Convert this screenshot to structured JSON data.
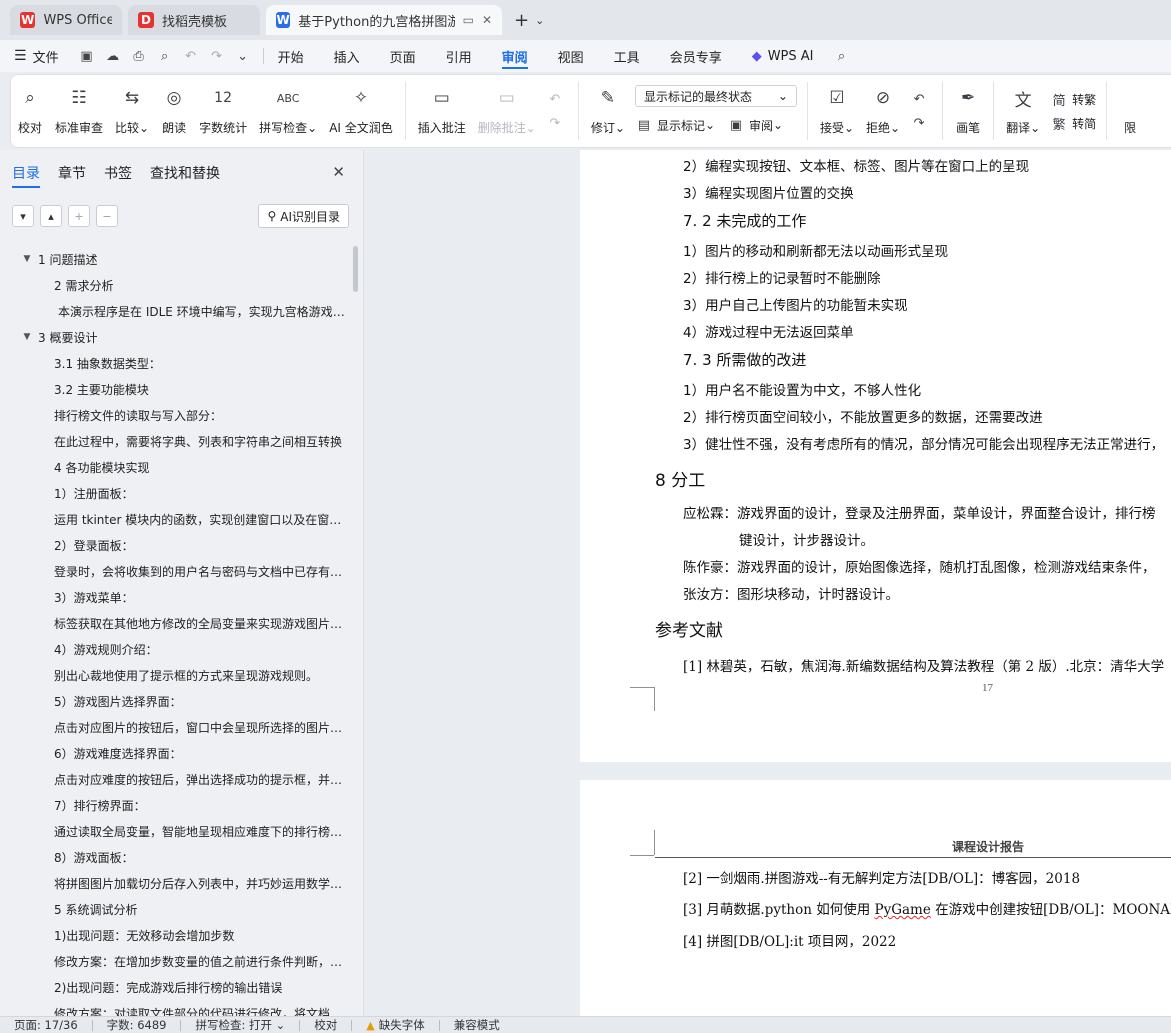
{
  "tabs": [
    {
      "label": "WPS Office",
      "logo": "W",
      "logo_color": "#e8322f"
    },
    {
      "label": "找稻壳模板",
      "logo": "D",
      "logo_color": "#e8322f"
    },
    {
      "label": "基于Python的九宫格拼图游戏",
      "logo": "W",
      "logo_color": "#2a6fe5"
    }
  ],
  "menu": {
    "file": "文件",
    "items": [
      "开始",
      "插入",
      "页面",
      "引用",
      "审阅",
      "视图",
      "工具",
      "会员专享"
    ],
    "active": "审阅",
    "wps_ai": "WPS AI"
  },
  "ribbon": {
    "proofread": "校对",
    "standard_review": "标准审查",
    "compare": "比较",
    "read_aloud": "朗读",
    "word_count": "字数统计",
    "spell_check": "拼写检查",
    "ai_polish": "AI 全文润色",
    "insert_comment": "插入批注",
    "delete_comment": "删除批注",
    "revise": "修订",
    "markup_state": "显示标记的最终状态",
    "show_markup": "显示标记",
    "review": "审阅",
    "accept": "接受",
    "reject": "拒绝",
    "pen": "画笔",
    "translate": "翻译",
    "to_traditional": "转繁",
    "to_simplified": "转简",
    "limit": "限"
  },
  "sidepanel": {
    "tabs": [
      "目录",
      "章节",
      "书签",
      "查找和替换"
    ],
    "ai_button": "AI识别目录",
    "toc": [
      {
        "text": "1  问题描述",
        "level": 1,
        "expanded": true
      },
      {
        "text": "2  需求分析",
        "level": 2
      },
      {
        "text": "本演示程序是在 IDLE 环境中编写，实现九宫格游戏的基本功能",
        "level": 2
      },
      {
        "text": "3  概要设计",
        "level": 1,
        "expanded": true
      },
      {
        "text": "3.1 抽象数据类型：",
        "level": 2
      },
      {
        "text": "3.2  主要功能模块",
        "level": 2
      },
      {
        "text": "排行榜文件的读取与写入部分：",
        "level": 3
      },
      {
        "text": "在此过程中，需要将字典、列表和字符串之间相互转换",
        "level": 3
      },
      {
        "text": "4 各功能模块实现",
        "level": 3
      },
      {
        "text": "1）注册面板：",
        "level": 3
      },
      {
        "text": "运用 tkinter 模块内的函数，实现创建窗口以及在窗口上布局",
        "level": 3
      },
      {
        "text": "2）登录面板：",
        "level": 3
      },
      {
        "text": "登录时，会将收集到的用户名与密码与文档中已存有的信息比对",
        "level": 3
      },
      {
        "text": "3）游戏菜单：",
        "level": 3
      },
      {
        "text": "标签获取在其他地方修改的全局变量来实现游戏图片的切换",
        "level": 3
      },
      {
        "text": "4）游戏规则介绍：",
        "level": 3
      },
      {
        "text": "别出心裁地使用了提示框的方式来呈现游戏规则。",
        "level": 3
      },
      {
        "text": "5）游戏图片选择界面：",
        "level": 3
      },
      {
        "text": "点击对应图片的按钮后，窗口中会呈现所选择的图片样式",
        "level": 3
      },
      {
        "text": "6）游戏难度选择界面：",
        "level": 3
      },
      {
        "text": "点击对应难度的按钮后，弹出选择成功的提示框，并设置难度",
        "level": 3
      },
      {
        "text": "7）排行榜界面：",
        "level": 3
      },
      {
        "text": "通过读取全局变量，智能地呈现相应难度下的排行榜信息",
        "level": 3
      },
      {
        "text": "8）游戏面板：",
        "level": 3
      },
      {
        "text": "将拼图图片加载切分后存入列表中，并巧妙运用数学方法打乱",
        "level": 3
      },
      {
        "text": "5  系统调试分析",
        "level": 3
      },
      {
        "text": "1)出现问题：无效移动会增加步数",
        "level": 3
      },
      {
        "text": "修改方案：在增加步数变量的值之前进行条件判断，避免无效移动",
        "level": 3
      },
      {
        "text": "2)出现问题：完成游戏后排行榜的输出错误",
        "level": 3
      },
      {
        "text": "修改方案：对读取文件部分的代码进行修改，将文档",
        "level": 3
      }
    ]
  },
  "document": {
    "page1": {
      "lines_top": [
        "2）编程实现按钮、文本框、标签、图片等在窗口上的呈现",
        "3）编程实现图片位置的交换"
      ],
      "h_7_2": "7. 2 未完成的工作",
      "lines_7_2": [
        "1）图片的移动和刷新都无法以动画形式呈现",
        "2）排行榜上的记录暂时不能删除",
        "3）用户自己上传图片的功能暂未实现",
        "4）游戏过程中无法返回菜单"
      ],
      "h_7_3": "7. 3 所需做的改进",
      "lines_7_3": [
        "1）用户名不能设置为中文，不够人性化",
        "2）排行榜页面空间较小，不能放置更多的数据，还需要改进",
        "3）健壮性不强，没有考虑所有的情况，部分情况可能会出现程序无法正常进行，"
      ],
      "h_8": "8  分工",
      "division": [
        "应松霖：游戏界面的设计，登录及注册界面，菜单设计，界面整合设计，排行榜",
        "键设计，计步器设计。",
        "陈作豪：游戏界面的设计，原始图像选择，随机打乱图像，检测游戏结束条件，",
        "张汝方：图形块移动，计时器设计。"
      ],
      "h_refs": "参考文献",
      "ref1": "[1]   林碧英，石敏，焦润海.新编数据结构及算法教程（第 2 版）.北京：清华大学",
      "page_number": "17"
    },
    "page2": {
      "header": "课程设计报告",
      "ref2": "[2]   一剑烟雨.拼图游戏--有无解判定方法[DB/OL]：博客园，2018",
      "ref3_a": "[3]   月萌数据.python 如何使用 ",
      "ref3_b": "PyGame",
      "ref3_c": " 在游戏中创建按钮[DB/OL]：MOONAPI",
      "ref4": "[4]   拼图[DB/OL]:it 项目网，2022"
    }
  },
  "status": {
    "page": "页面: 17/36",
    "words": "字数: 6489",
    "spell": "拼写检查: 打开",
    "proof": "校对",
    "missing_font": "缺失字体",
    "compat": "兼容模式"
  }
}
